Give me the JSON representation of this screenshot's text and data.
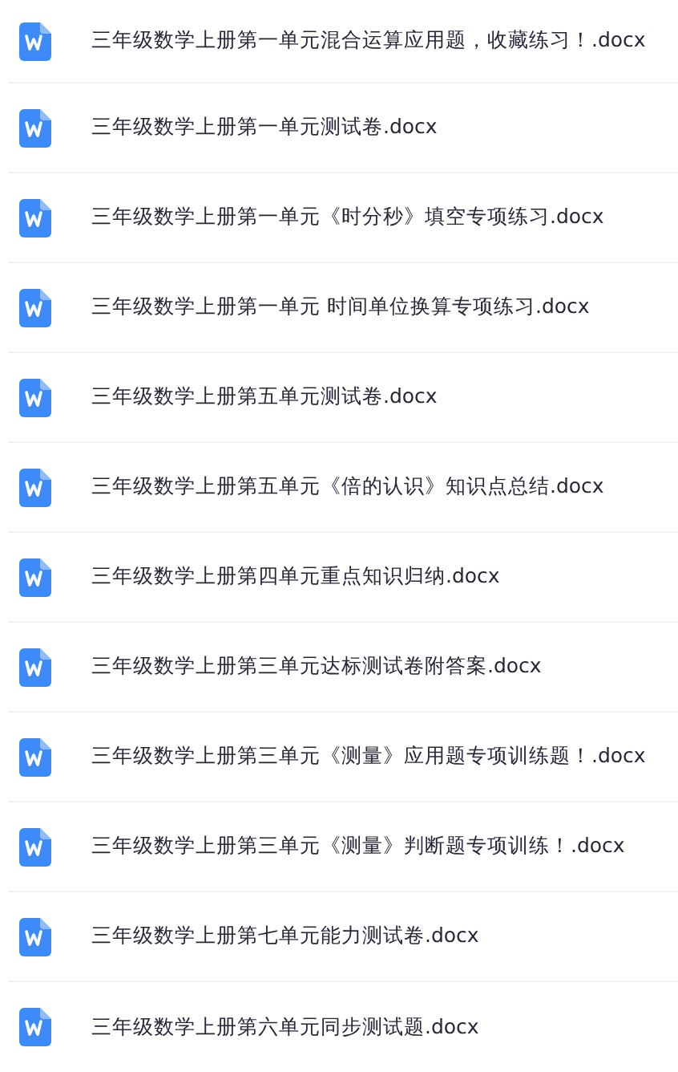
{
  "files": [
    {
      "name": "三年级数学上册第一单元混合运算应用题，收藏练习！.docx"
    },
    {
      "name": "三年级数学上册第一单元测试卷.docx"
    },
    {
      "name": "三年级数学上册第一单元《时分秒》填空专项练习.docx"
    },
    {
      "name": "三年级数学上册第一单元 时间单位换算专项练习.docx"
    },
    {
      "name": "三年级数学上册第五单元测试卷.docx"
    },
    {
      "name": "三年级数学上册第五单元《倍的认识》知识点总结.docx"
    },
    {
      "name": "三年级数学上册第四单元重点知识归纳.docx"
    },
    {
      "name": "三年级数学上册第三单元达标测试卷附答案.docx"
    },
    {
      "name": "三年级数学上册第三单元《测量》应用题专项训练题！.docx"
    },
    {
      "name": "三年级数学上册第三单元《测量》判断题专项训练！.docx"
    },
    {
      "name": "三年级数学上册第七单元能力测试卷.docx"
    },
    {
      "name": "三年级数学上册第六单元同步测试题.docx"
    }
  ]
}
